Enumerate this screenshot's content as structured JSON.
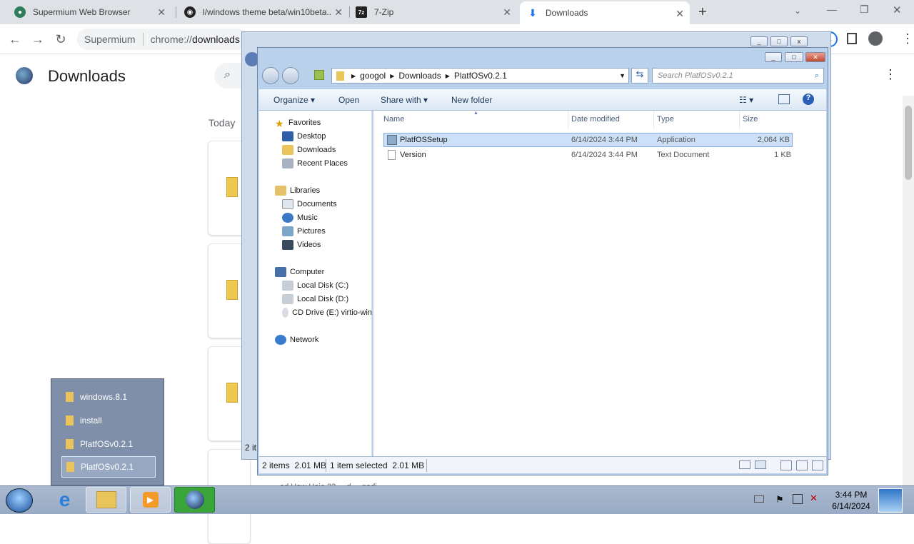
{
  "tabs": [
    {
      "title": "Supermium Web Browser",
      "icon": "globe-icon"
    },
    {
      "title": "l/windows theme beta/win10beta...",
      "icon": "github-icon"
    },
    {
      "title": "7-Zip",
      "icon": "7zip-icon"
    },
    {
      "title": "Downloads",
      "icon": "download-icon"
    }
  ],
  "new_tab": "+",
  "omnibox": {
    "site": "Supermium",
    "url_prefix": "chrome://",
    "url_bold": "downloads"
  },
  "downloads_page": {
    "title": "Downloads",
    "section": "Today",
    "bottom_text": "2 it",
    "bottom_line": "ad How Hoie 32 ... d ... nadi"
  },
  "explorer": {
    "breadcrumb": [
      "googol",
      "Downloads",
      "PlatfOSv0.2.1"
    ],
    "search_placeholder": "Search PlatfOSv0.2.1",
    "commands": {
      "organize": "Organize",
      "open": "Open",
      "share": "Share with",
      "new_folder": "New folder"
    },
    "nav": {
      "favorites": "Favorites",
      "desktop": "Desktop",
      "downloads": "Downloads",
      "recent": "Recent Places",
      "libraries": "Libraries",
      "documents": "Documents",
      "music": "Music",
      "pictures": "Pictures",
      "videos": "Videos",
      "computer": "Computer",
      "c": "Local Disk (C:)",
      "d": "Local Disk (D:)",
      "e": "CD Drive (E:) virtio-win",
      "network": "Network"
    },
    "columns": {
      "name": "Name",
      "date": "Date modified",
      "type": "Type",
      "size": "Size"
    },
    "files": [
      {
        "name": "PlatfOSSetup",
        "date": "6/14/2024 3:44 PM",
        "type": "Application",
        "size": "2,064 KB"
      },
      {
        "name": "Version",
        "date": "6/14/2024 3:44 PM",
        "type": "Text Document",
        "size": "1 KB"
      }
    ],
    "status": {
      "items": "2 items",
      "size": "2.01 MB",
      "selected": "1 item selected",
      "sel_size": "2.01 MB"
    }
  },
  "jumplist": [
    "windows.8.1",
    "install",
    "PlatfOSv0.2.1",
    "PlatfOSv0.2.1"
  ],
  "clock": {
    "time": "3:44 PM",
    "date": "6/14/2024"
  }
}
